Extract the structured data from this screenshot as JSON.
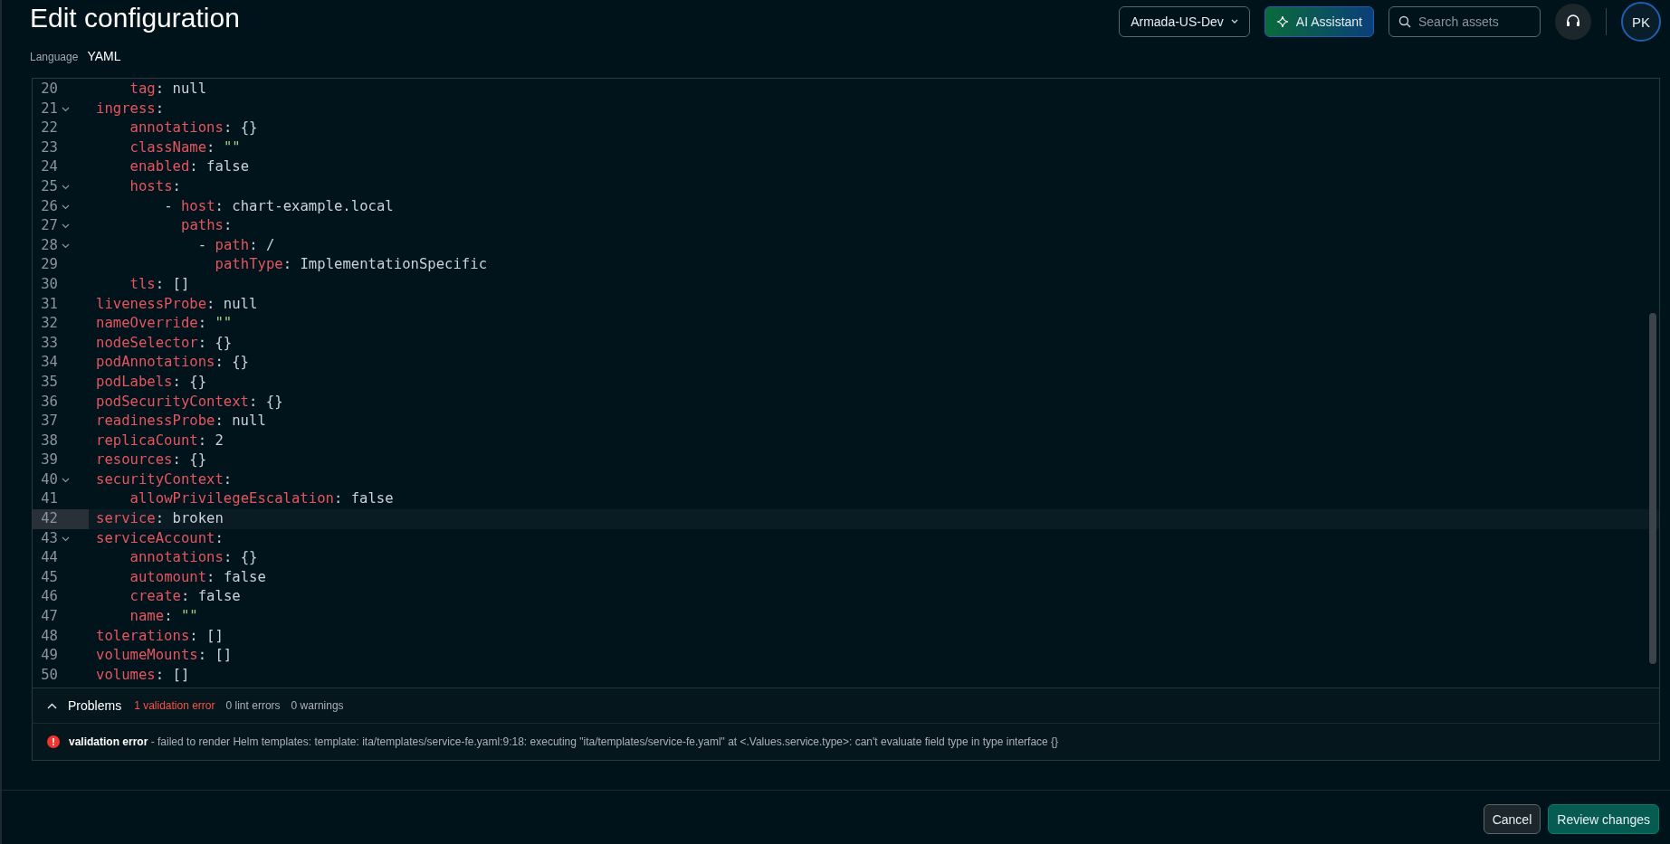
{
  "header": {
    "title": "Edit configuration",
    "language_label": "Language",
    "language": "YAML"
  },
  "topbar": {
    "environment": "Armada-US-Dev",
    "assistant": "AI Assistant",
    "search_placeholder": "Search assets",
    "avatar": "PK"
  },
  "editor": {
    "lines": [
      {
        "kind": "hidden",
        "children": [
          {
            "number": "20",
            "key": "tag",
            "punct": ":",
            "value": "null",
            "kind": "scalar",
            "current": false
          }
        ]
      },
      {
        "number": "21",
        "key": "ingress",
        "punct": ":",
        "kind": "mapping",
        "expanded": true,
        "current": false,
        "children": [
          {
            "number": "22",
            "key": "annotations",
            "punct": ":",
            "value": "{}",
            "kind": "scalar",
            "current": false
          },
          {
            "number": "23",
            "key": "className",
            "punct": ":",
            "value": "\"\"",
            "kind": "string",
            "current": false
          },
          {
            "number": "24",
            "key": "enabled",
            "punct": ":",
            "value": "false",
            "kind": "scalar",
            "current": false
          },
          {
            "number": "25",
            "key": "hosts",
            "punct": ":",
            "kind": "mapping",
            "expanded": true,
            "current": false,
            "children": [
              {
                "number": "26",
                "bullet": "-",
                "key": "host",
                "punct": ":",
                "value": "chart-example.local",
                "kind": "scalar",
                "expanded": true,
                "current": false,
                "children": [
                  {
                    "number": "27",
                    "key": "paths",
                    "punct": ":",
                    "kind": "mapping",
                    "expanded": true,
                    "current": false,
                    "children": [
                      {
                        "number": "28",
                        "bullet": "-",
                        "key": "path",
                        "punct": ":",
                        "value": "/",
                        "kind": "scalar",
                        "expanded": true,
                        "current": false,
                        "children": [
                          {
                            "number": "29",
                            "key": "pathType",
                            "punct": ":",
                            "value": "ImplementationSpecific",
                            "kind": "scalar",
                            "current": false
                          }
                        ]
                      }
                    ]
                  }
                ]
              }
            ]
          },
          {
            "number": "30",
            "key": "tls",
            "punct": ":",
            "value": "[]",
            "kind": "scalar",
            "current": false
          }
        ]
      },
      {
        "number": "31",
        "key": "livenessProbe",
        "punct": ":",
        "value": "null",
        "kind": "scalar",
        "current": false
      },
      {
        "number": "32",
        "key": "nameOverride",
        "punct": ":",
        "value": "\"\"",
        "kind": "string",
        "current": false
      },
      {
        "number": "33",
        "key": "nodeSelector",
        "punct": ":",
        "value": "{}",
        "kind": "scalar",
        "current": false
      },
      {
        "number": "34",
        "key": "podAnnotations",
        "punct": ":",
        "value": "{}",
        "kind": "scalar",
        "current": false
      },
      {
        "number": "35",
        "key": "podLabels",
        "punct": ":",
        "value": "{}",
        "kind": "scalar",
        "current": false
      },
      {
        "number": "36",
        "key": "podSecurityContext",
        "punct": ":",
        "value": "{}",
        "kind": "scalar",
        "current": false
      },
      {
        "number": "37",
        "key": "readinessProbe",
        "punct": ":",
        "value": "null",
        "kind": "scalar",
        "current": false
      },
      {
        "number": "38",
        "key": "replicaCount",
        "punct": ":",
        "value": "2",
        "kind": "scalar",
        "current": false
      },
      {
        "number": "39",
        "key": "resources",
        "punct": ":",
        "value": "{}",
        "kind": "scalar",
        "current": false
      },
      {
        "number": "40",
        "key": "securityContext",
        "punct": ":",
        "kind": "mapping",
        "expanded": true,
        "current": false,
        "children": [
          {
            "number": "41",
            "key": "allowPrivilegeEscalation",
            "punct": ":",
            "value": "false",
            "kind": "scalar",
            "current": false
          }
        ]
      },
      {
        "number": "42",
        "key": "service",
        "punct": ":",
        "value": "broken",
        "kind": "scalar",
        "current": true
      },
      {
        "number": "43",
        "key": "serviceAccount",
        "punct": ":",
        "kind": "mapping",
        "expanded": true,
        "current": false,
        "children": [
          {
            "number": "44",
            "key": "annotations",
            "punct": ":",
            "value": "{}",
            "kind": "scalar",
            "current": false
          },
          {
            "number": "45",
            "key": "automount",
            "punct": ":",
            "value": "false",
            "kind": "scalar",
            "current": false
          },
          {
            "number": "46",
            "key": "create",
            "punct": ":",
            "value": "false",
            "kind": "scalar",
            "current": false
          },
          {
            "number": "47",
            "key": "name",
            "punct": ":",
            "value": "\"\"",
            "kind": "string",
            "current": false
          }
        ]
      },
      {
        "number": "48",
        "key": "tolerations",
        "punct": ":",
        "value": "[]",
        "kind": "scalar",
        "current": false
      },
      {
        "number": "49",
        "key": "volumeMounts",
        "punct": ":",
        "value": "[]",
        "kind": "scalar",
        "current": false
      },
      {
        "number": "50",
        "key": "volumes",
        "punct": ":",
        "value": "[]",
        "kind": "scalar",
        "current": false
      }
    ]
  },
  "problems": {
    "title": "Problems",
    "expanded": true,
    "counts": [
      {
        "text": "1 validation error",
        "kind": "error"
      },
      {
        "text": "0 lint errors",
        "kind": "plain"
      },
      {
        "text": "0 warnings",
        "kind": "plain"
      }
    ],
    "items": [
      {
        "kind": "error",
        "text": "**validation error** - failed to render Helm templates: template: ita/templates/service-fe.yaml:9:18: executing \"ita/templates/service-fe.yaml\" at <.Values.service.type>: can't evaluate field type in type interface {}"
      }
    ]
  },
  "footer": {
    "buttons": [
      {
        "label": "Cancel",
        "kind": "secondary"
      },
      {
        "label": "Review changes",
        "kind": "primary"
      }
    ]
  }
}
